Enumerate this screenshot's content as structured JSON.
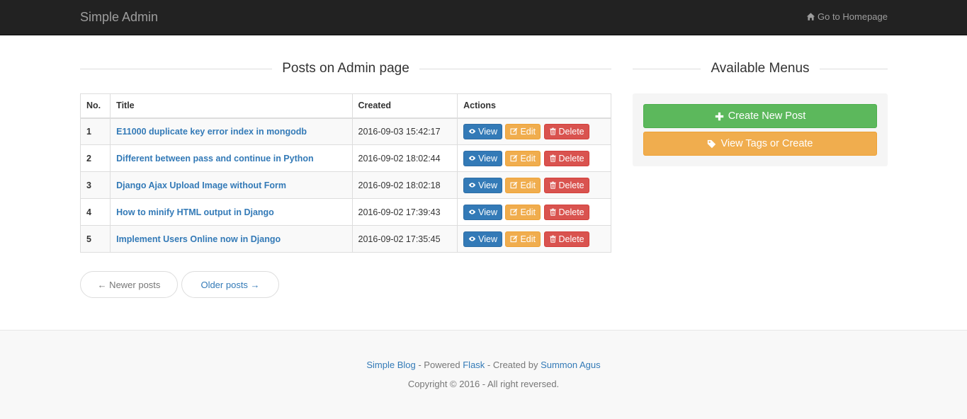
{
  "navbar": {
    "brand": "Simple Admin",
    "homepage_link": "Go to Homepage",
    "homepage_icon": "home-icon"
  },
  "posts_section": {
    "title": "Posts on Admin page",
    "columns": [
      "No.",
      "Title",
      "Created",
      "Actions"
    ],
    "rows": [
      {
        "no": "1",
        "title": "E11000 duplicate key error index in mongodb",
        "created": "2016-09-03 15:42:17"
      },
      {
        "no": "2",
        "title": "Different between pass and continue in Python",
        "created": "2016-09-02 18:02:44"
      },
      {
        "no": "3",
        "title": "Django Ajax Upload Image without Form",
        "created": "2016-09-02 18:02:18"
      },
      {
        "no": "4",
        "title": "How to minify HTML output in Django",
        "created": "2016-09-02 17:39:43"
      },
      {
        "no": "5",
        "title": "Implement Users Online now in Django",
        "created": "2016-09-02 17:35:45"
      }
    ],
    "actions": {
      "view": "View",
      "edit": "Edit",
      "delete": "Delete"
    },
    "pager": {
      "newer": "← Newer posts",
      "older": "Older posts →"
    }
  },
  "menus_section": {
    "title": "Available Menus",
    "create_post": "Create New Post",
    "view_tags": "View Tags or Create"
  },
  "footer": {
    "blog_link": "Simple Blog",
    "powered_text": " - Powered ",
    "flask_link": "Flask",
    "created_text": " - Created by ",
    "author_link": "Summon Agus",
    "copyright": "Copyright © 2016 - All right reversed."
  },
  "colors": {
    "navbar": "#222222",
    "primary": "#337ab7",
    "success": "#5cb85c",
    "warning": "#f0ad4e",
    "danger": "#d9534f"
  }
}
